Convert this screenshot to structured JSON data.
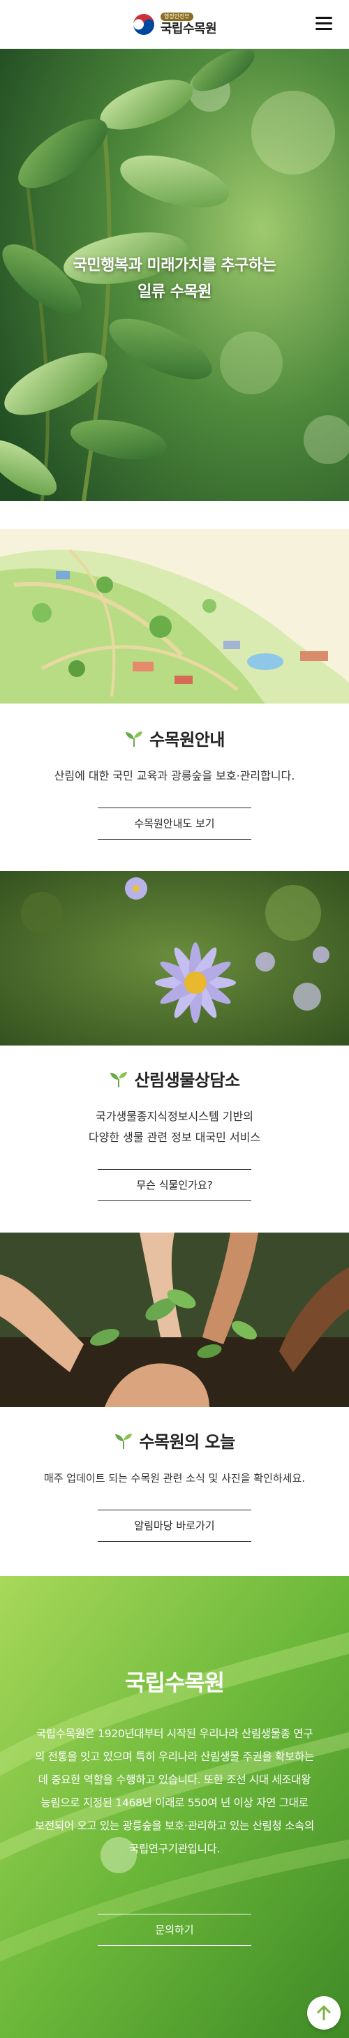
{
  "header": {
    "logo_tag": "행정안전부",
    "logo_name": "국립수목원",
    "menu_icon": "hamburger-menu-icon"
  },
  "hero": {
    "line1": "국민행복과 미래가치를 추구하는",
    "line2": "일류 수목원"
  },
  "sections": [
    {
      "title": "수목원안내",
      "desc_lines": [
        "산림에 대한 국민 교육과 광릉숲을 보호·관리합니다."
      ],
      "button": "수목원안내도 보기"
    },
    {
      "title": "산림생물상담소",
      "desc_lines": [
        "국가생물종지식정보시스템 기반의",
        "다양한 생물 관련 정보 대국민 서비스"
      ],
      "button": "무슨 식물인가요?"
    },
    {
      "title": "수목원의 오늘",
      "desc_lines": [
        "매주 업데이트 되는 수목원 관련 소식 및 사진을 확인하세요."
      ],
      "button": "알림마당 바로가기"
    }
  ],
  "about": {
    "title": "국립수목원",
    "desc": "국립수목원은 1920년대부터 시작된 우리나라 산림생물종 연구의 전통을 잇고 있으며 특히 우리나라 산림생물 주권을 확보하는데 중요한 역할을 수행하고 있습니다. 또한 조선 시대 세조대왕 능림으로 지정된 1468년 이래로 550여 년 이상 자연 그대로 보전되어 오고 있는 광릉숲을 보호·관리하고 있는 산림청 소속의 국립연구기관입니다.",
    "button": "문의하기"
  },
  "scroll_top_icon": "arrow-up-icon",
  "colors": {
    "accent_green": "#6aa84f",
    "button_border": "#222222",
    "top_button_arrow": "#7cb342"
  }
}
